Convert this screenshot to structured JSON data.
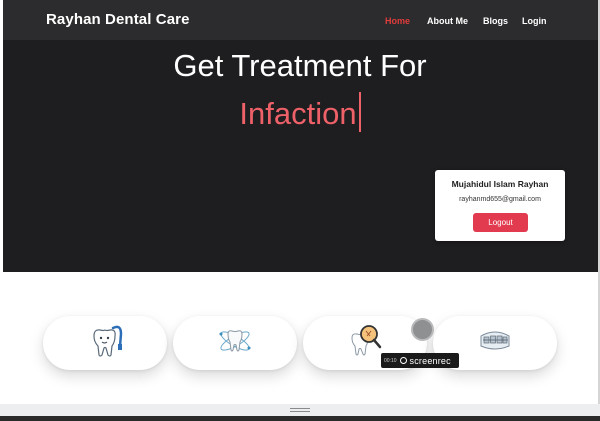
{
  "navbar": {
    "brand": "Rayhan Dental Care",
    "links": [
      {
        "label": "Home",
        "active": true
      },
      {
        "label": "About Me",
        "active": false
      },
      {
        "label": "Blogs",
        "active": false
      },
      {
        "label": "Login",
        "active": false
      }
    ]
  },
  "hero": {
    "headline": "Get Treatment For",
    "typed_text": "Infaction"
  },
  "profile": {
    "name": "Mujahidul Islam Rayhan",
    "email": "rayhanmd655@gmail.com",
    "logout_label": "Logout"
  },
  "services": [
    {
      "icon": "tooth-brushing-icon"
    },
    {
      "icon": "tooth-atom-icon"
    },
    {
      "icon": "tooth-magnifier-icon"
    },
    {
      "icon": "dental-brace-icon"
    }
  ],
  "recorder": {
    "time": "00:10",
    "brand": "screenrec"
  },
  "colors": {
    "accent": "#e23c3c",
    "typed": "#ee6168",
    "hero_bg": "#1e1d20",
    "nav_bg": "#2c2b2d",
    "logout": "#e23a4f"
  }
}
